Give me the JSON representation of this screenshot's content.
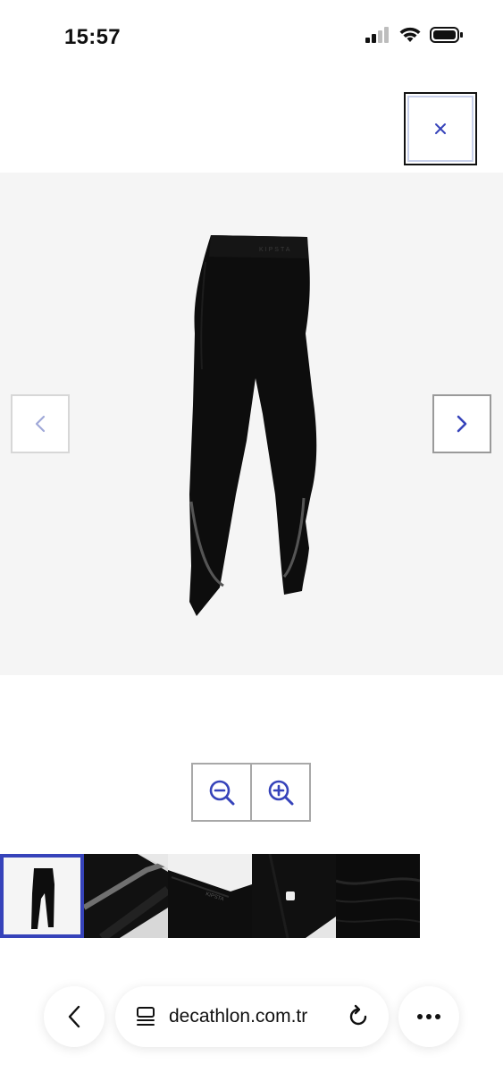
{
  "status_bar": {
    "time": "15:57"
  },
  "viewer": {
    "close_label": "×"
  },
  "browser": {
    "url": "decathlon.com.tr"
  },
  "colors": {
    "accent": "#3643ba",
    "viewer_bg": "#f5f5f5"
  },
  "icons": {
    "close": "close-icon",
    "prev": "chevron-left-icon",
    "next": "chevron-right-icon",
    "zoom_out": "zoom-out-icon",
    "zoom_in": "zoom-in-icon",
    "back": "back-icon",
    "tabs": "reader-icon",
    "reload": "reload-icon",
    "more": "more-icon"
  }
}
